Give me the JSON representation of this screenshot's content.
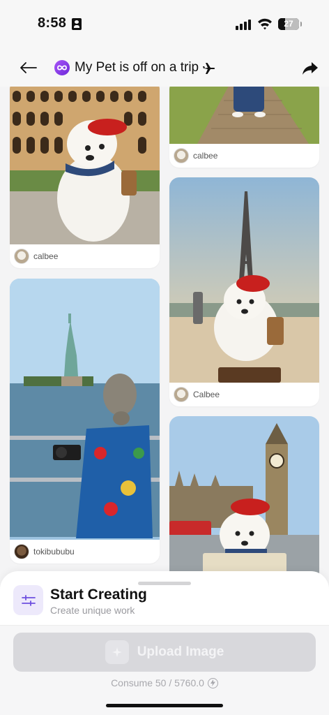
{
  "status_bar": {
    "time": "8:58",
    "battery": "27"
  },
  "header": {
    "title": "My Pet is off on a trip"
  },
  "feed": {
    "cards": [
      {
        "username": "calbee",
        "scene": "dog-at-colosseum"
      },
      {
        "username": "tokibububu",
        "scene": "dog-at-statue-of-liberty"
      },
      {
        "username": "calbee",
        "scene": "dog-on-path"
      },
      {
        "username": "Calbee",
        "scene": "dog-at-eiffel-tower"
      },
      {
        "username": "",
        "scene": "dog-at-big-ben"
      }
    ]
  },
  "sheet": {
    "title": "Start Creating",
    "subtitle": "Create unique work",
    "upload_label": "Upload Image",
    "consume_text": "Consume 50 / 5760.0"
  },
  "colors": {
    "accent": "#7c3aed",
    "upload_disabled": "#d8d8dc",
    "settings_bg": "#ede9fb"
  }
}
